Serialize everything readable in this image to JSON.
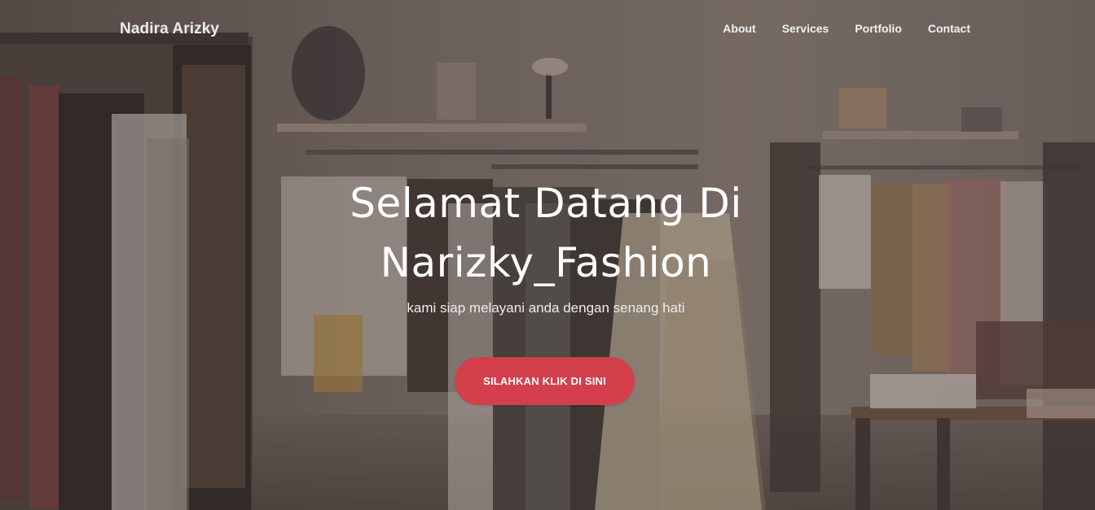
{
  "navbar": {
    "brand": "Nadira Arizky",
    "links": [
      {
        "label": "About"
      },
      {
        "label": "Services"
      },
      {
        "label": "Portfolio"
      },
      {
        "label": "Contact"
      }
    ]
  },
  "hero": {
    "title": "Selamat Datang Di Narizky_Fashion",
    "subtitle": "kami siap melayani anda dengan senang hati",
    "cta_label": "SILAHKAN KLIK DI SINI",
    "accent_color": "#d33f4b",
    "overlay_color": "#3c302c",
    "background_description": "clothing-store-background"
  }
}
